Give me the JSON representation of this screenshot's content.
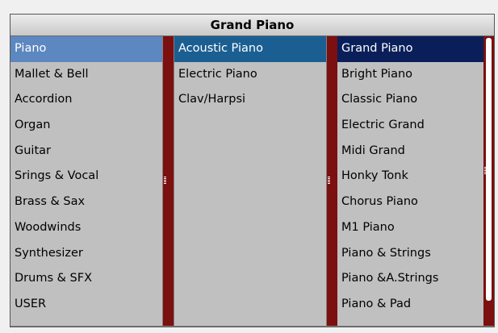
{
  "title": "Grand Piano",
  "categories": [
    {
      "label": "Piano"
    },
    {
      "label": "Mallet & Bell"
    },
    {
      "label": "Accordion"
    },
    {
      "label": "Organ"
    },
    {
      "label": "Guitar"
    },
    {
      "label": "Srings & Vocal"
    },
    {
      "label": "Brass & Sax"
    },
    {
      "label": "Woodwinds"
    },
    {
      "label": "Synthesizer"
    },
    {
      "label": "Drums & SFX"
    },
    {
      "label": "USER"
    }
  ],
  "subcategories": [
    {
      "label": "Acoustic Piano"
    },
    {
      "label": "Electric Piano"
    },
    {
      "label": "Clav/Harpsi"
    }
  ],
  "sounds": [
    {
      "label": "Grand Piano"
    },
    {
      "label": "Bright Piano"
    },
    {
      "label": "Classic Piano"
    },
    {
      "label": "Electric Grand"
    },
    {
      "label": "Midi Grand"
    },
    {
      "label": "Honky Tonk"
    },
    {
      "label": "Chorus Piano"
    },
    {
      "label": "M1 Piano"
    },
    {
      "label": "Piano & Strings"
    },
    {
      "label": "Piano &A.Strings"
    },
    {
      "label": "Piano & Pad"
    }
  ],
  "selected": {
    "category": "Piano",
    "subcategory": "Acoustic Piano",
    "sound": "Grand Piano"
  },
  "colors": {
    "scrollbar": "#7c0f0f",
    "selected_category": "#5d87c0",
    "selected_subcategory": "#1b5f92",
    "selected_sound": "#0a1f5a"
  }
}
